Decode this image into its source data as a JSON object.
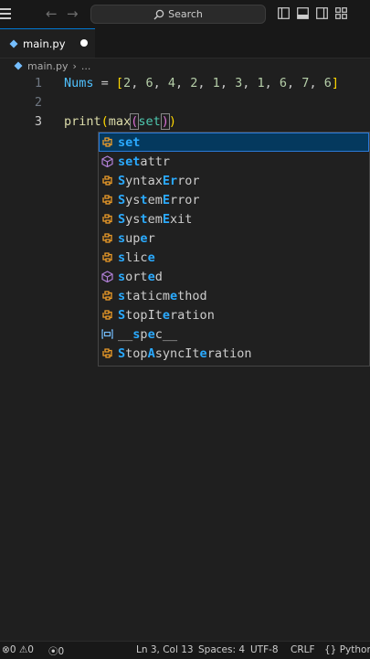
{
  "title_bar": {
    "search_placeholder": "Search"
  },
  "tab": {
    "label": "main.py",
    "modified": true
  },
  "breadcrumb": {
    "file": "main.py",
    "more": "..."
  },
  "editor": {
    "lines": [
      {
        "number": "1",
        "text": "Nums = [2, 6, 4, 2, 1, 3, 1, 6, 7, 6]"
      },
      {
        "number": "2",
        "text": ""
      },
      {
        "number": "3",
        "text": "print(max(set))"
      }
    ],
    "cursor": {
      "line": 3,
      "column": 13
    }
  },
  "suggestions": [
    {
      "label": "set",
      "icon": "class-icon",
      "match": [
        0,
        1,
        2
      ],
      "selected": true
    },
    {
      "label": "setattr",
      "icon": "method-cube-icon",
      "match": [
        0,
        1,
        2
      ],
      "selected": false
    },
    {
      "label": "SyntaxError",
      "icon": "class-icon",
      "match": [
        0,
        6,
        7
      ],
      "selected": false
    },
    {
      "label": "SystemError",
      "icon": "class-icon",
      "match": [
        0,
        3,
        6
      ],
      "selected": false
    },
    {
      "label": "SystemExit",
      "icon": "class-icon",
      "match": [
        0,
        3,
        6
      ],
      "selected": false
    },
    {
      "label": "super",
      "icon": "class-icon",
      "match": [
        0,
        3
      ],
      "selected": false
    },
    {
      "label": "slice",
      "icon": "class-icon",
      "match": [
        0,
        4
      ],
      "selected": false
    },
    {
      "label": "sorted",
      "icon": "method-cube-icon",
      "match": [
        0,
        4
      ],
      "selected": false
    },
    {
      "label": "staticmethod",
      "icon": "class-icon",
      "match": [
        0,
        7
      ],
      "selected": false
    },
    {
      "label": "StopIteration",
      "icon": "class-icon",
      "match": [
        0,
        6
      ],
      "selected": false
    },
    {
      "label": "__spec__",
      "icon": "variable-icon",
      "match": [
        2,
        4
      ],
      "selected": false
    },
    {
      "label": "StopAsyncIteration",
      "icon": "class-icon",
      "match": [
        0,
        4,
        11
      ],
      "selected": false
    }
  ],
  "status_bar": {
    "errors": "0",
    "warnings": "0",
    "ports": "0",
    "cursor_position": "Ln 3, Col 13",
    "spaces": "Spaces: 4",
    "encoding": "UTF-8",
    "line_ending": "CRLF",
    "language": "Python"
  },
  "colors": {
    "background": "#1f1f1f",
    "accent": "#0078d4",
    "selection": "#04395e",
    "variable": "#4fc1ff",
    "bracket": "#ffd700",
    "number": "#b5cea8",
    "function": "#dcdcaa"
  }
}
